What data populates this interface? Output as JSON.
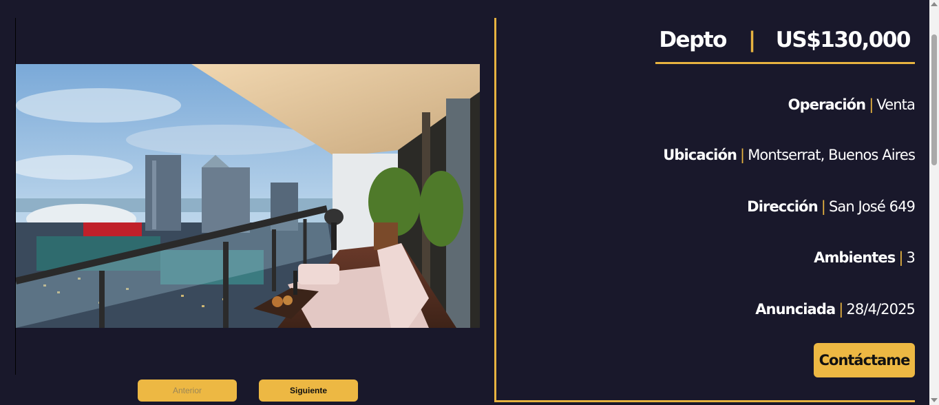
{
  "listing": {
    "type": "Depto",
    "price": "US$130,000"
  },
  "details": [
    {
      "label": "Operación",
      "value": "Venta"
    },
    {
      "label": "Ubicación",
      "value": "Montserrat, Buenos Aires"
    },
    {
      "label": "Dirección",
      "value": "San José 649"
    },
    {
      "label": "Ambientes",
      "value": "3"
    },
    {
      "label": "Anunciada",
      "value": "28/4/2025"
    }
  ],
  "separator": "|",
  "buttons": {
    "contact": "Contáctame",
    "prev": "Anterior",
    "next": "Siguiente"
  },
  "colors": {
    "background": "#19182b",
    "accent": "#e7b340",
    "button": "#edb843"
  }
}
